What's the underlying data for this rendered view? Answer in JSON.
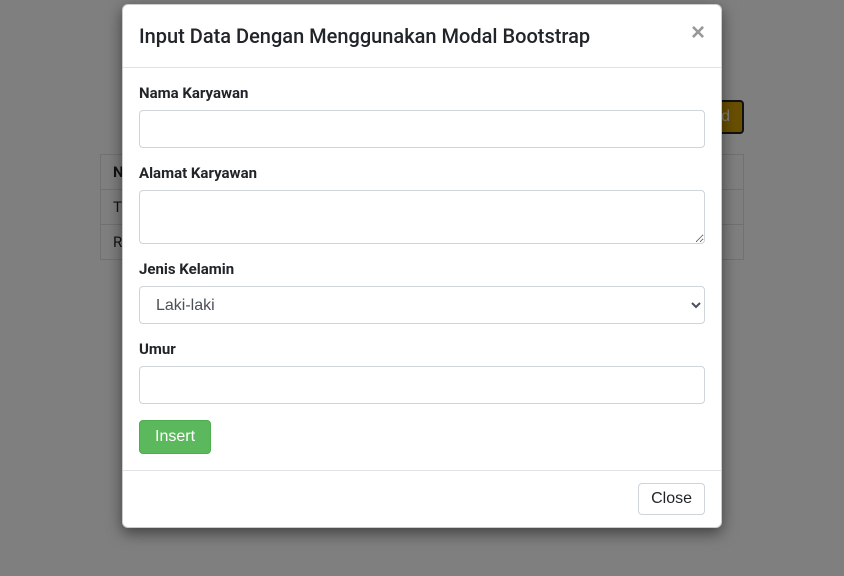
{
  "background": {
    "add_button_label": "Add",
    "table_header": "Nama",
    "row1": "Trisna",
    "row2": "Rini"
  },
  "modal": {
    "title": "Input Data Dengan Menggunakan Modal Bootstrap",
    "close_x": "×",
    "form": {
      "nama_label": "Nama Karyawan",
      "nama_value": "",
      "alamat_label": "Alamat Karyawan",
      "alamat_value": "",
      "jenis_label": "Jenis Kelamin",
      "jenis_selected": "Laki-laki",
      "umur_label": "Umur",
      "umur_value": ""
    },
    "insert_label": "Insert",
    "close_label": "Close"
  }
}
